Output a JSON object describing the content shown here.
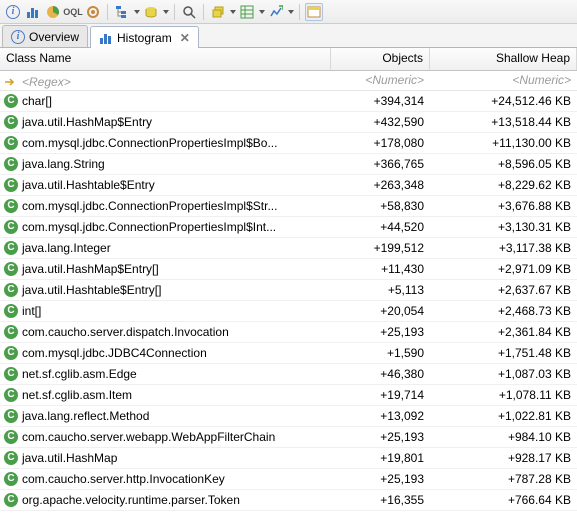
{
  "toolbar": {
    "icons": [
      "info",
      "bars",
      "pie",
      "sql",
      "gear",
      "tree",
      "db",
      "search",
      "layers",
      "grid",
      "graph",
      "hist"
    ]
  },
  "tabs": [
    {
      "label": "Overview",
      "icon": "info",
      "active": false,
      "closable": false
    },
    {
      "label": "Histogram",
      "icon": "bars",
      "active": true,
      "closable": true
    }
  ],
  "columns": {
    "class_name": "Class Name",
    "objects": "Objects",
    "shallow_heap": "Shallow Heap"
  },
  "filter": {
    "regex": "<Regex>",
    "numeric": "<Numeric>"
  },
  "rows": [
    {
      "class": "char[]",
      "objects": "+394,314",
      "heap": "+24,512.46 KB"
    },
    {
      "class": "java.util.HashMap$Entry",
      "objects": "+432,590",
      "heap": "+13,518.44 KB"
    },
    {
      "class": "com.mysql.jdbc.ConnectionPropertiesImpl$Bo...",
      "objects": "+178,080",
      "heap": "+11,130.00 KB"
    },
    {
      "class": "java.lang.String",
      "objects": "+366,765",
      "heap": "+8,596.05 KB"
    },
    {
      "class": "java.util.Hashtable$Entry",
      "objects": "+263,348",
      "heap": "+8,229.62 KB"
    },
    {
      "class": "com.mysql.jdbc.ConnectionPropertiesImpl$Str...",
      "objects": "+58,830",
      "heap": "+3,676.88 KB"
    },
    {
      "class": "com.mysql.jdbc.ConnectionPropertiesImpl$Int...",
      "objects": "+44,520",
      "heap": "+3,130.31 KB"
    },
    {
      "class": "java.lang.Integer",
      "objects": "+199,512",
      "heap": "+3,117.38 KB"
    },
    {
      "class": "java.util.HashMap$Entry[]",
      "objects": "+11,430",
      "heap": "+2,971.09 KB"
    },
    {
      "class": "java.util.Hashtable$Entry[]",
      "objects": "+5,113",
      "heap": "+2,637.67 KB"
    },
    {
      "class": "int[]",
      "objects": "+20,054",
      "heap": "+2,468.73 KB"
    },
    {
      "class": "com.caucho.server.dispatch.Invocation",
      "objects": "+25,193",
      "heap": "+2,361.84 KB"
    },
    {
      "class": "com.mysql.jdbc.JDBC4Connection",
      "objects": "+1,590",
      "heap": "+1,751.48 KB"
    },
    {
      "class": "net.sf.cglib.asm.Edge",
      "objects": "+46,380",
      "heap": "+1,087.03 KB"
    },
    {
      "class": "net.sf.cglib.asm.Item",
      "objects": "+19,714",
      "heap": "+1,078.11 KB"
    },
    {
      "class": "java.lang.reflect.Method",
      "objects": "+13,092",
      "heap": "+1,022.81 KB"
    },
    {
      "class": "com.caucho.server.webapp.WebAppFilterChain",
      "objects": "+25,193",
      "heap": "+984.10 KB"
    },
    {
      "class": "java.util.HashMap",
      "objects": "+19,801",
      "heap": "+928.17 KB"
    },
    {
      "class": "com.caucho.server.http.InvocationKey",
      "objects": "+25,193",
      "heap": "+787.28 KB"
    },
    {
      "class": "org.apache.velocity.runtime.parser.Token",
      "objects": "+16,355",
      "heap": "+766.64 KB"
    }
  ]
}
